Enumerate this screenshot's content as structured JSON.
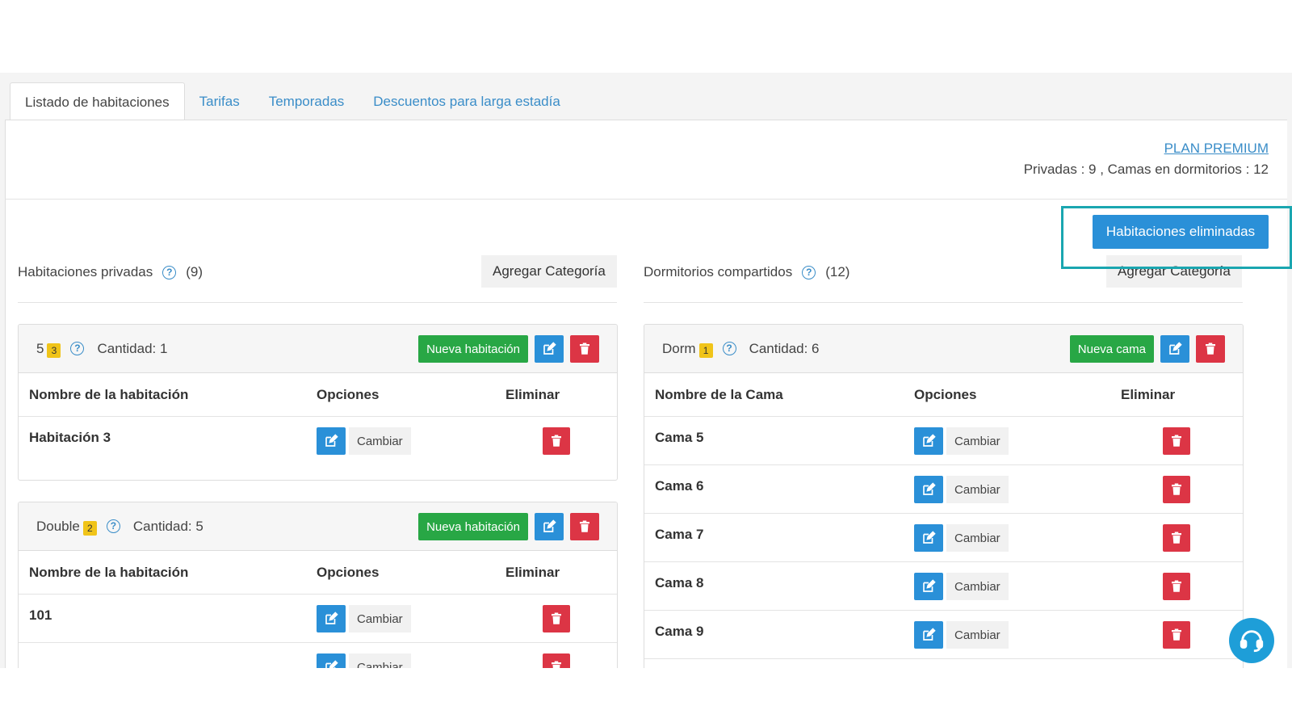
{
  "tabs": [
    "Listado de habitaciones",
    "Tarifas",
    "Temporadas",
    "Descuentos para larga estadía"
  ],
  "plan_link": "PLAN PREMIUM",
  "summary": "Privadas : 9 , Camas en dormitorios : 12",
  "deleted_button": "Habitaciones eliminadas",
  "private": {
    "title": "Habitaciones privadas",
    "count": "(9)",
    "add_category": "Agregar Categoría",
    "cards": [
      {
        "name": "5",
        "badge": "3",
        "quantity": "Cantidad: 1",
        "new_label": "Nueva habitación",
        "col_name": "Nombre de la habitación",
        "col_options": "Opciones",
        "col_delete": "Eliminar",
        "rows": [
          "Habitación 3"
        ]
      },
      {
        "name": "Double",
        "badge": "2",
        "quantity": "Cantidad: 5",
        "new_label": "Nueva habitación",
        "col_name": "Nombre de la habitación",
        "col_options": "Opciones",
        "col_delete": "Eliminar",
        "rows": [
          "101"
        ]
      }
    ]
  },
  "shared": {
    "title": "Dormitorios compartidos",
    "count": "(12)",
    "add_category": "Agregar Categoría",
    "card": {
      "name": "Dorm",
      "badge": "1",
      "quantity": "Cantidad: 6",
      "new_label": "Nueva cama",
      "col_name": "Nombre de la Cama",
      "col_options": "Opciones",
      "col_delete": "Eliminar",
      "rows": [
        "Cama 5",
        "Cama 6",
        "Cama 7",
        "Cama 8",
        "Cama 9"
      ]
    }
  },
  "change_label": "Cambiar",
  "help_glyph": "?",
  "icons": {
    "edit": "edit-icon",
    "delete": "trash-icon",
    "help": "help-icon",
    "support": "headset-icon"
  },
  "colors": {
    "primary": "#2a90d8",
    "success": "#28a745",
    "danger": "#dc3545",
    "highlight": "#1aa6b0",
    "badge": "#f0c419"
  }
}
